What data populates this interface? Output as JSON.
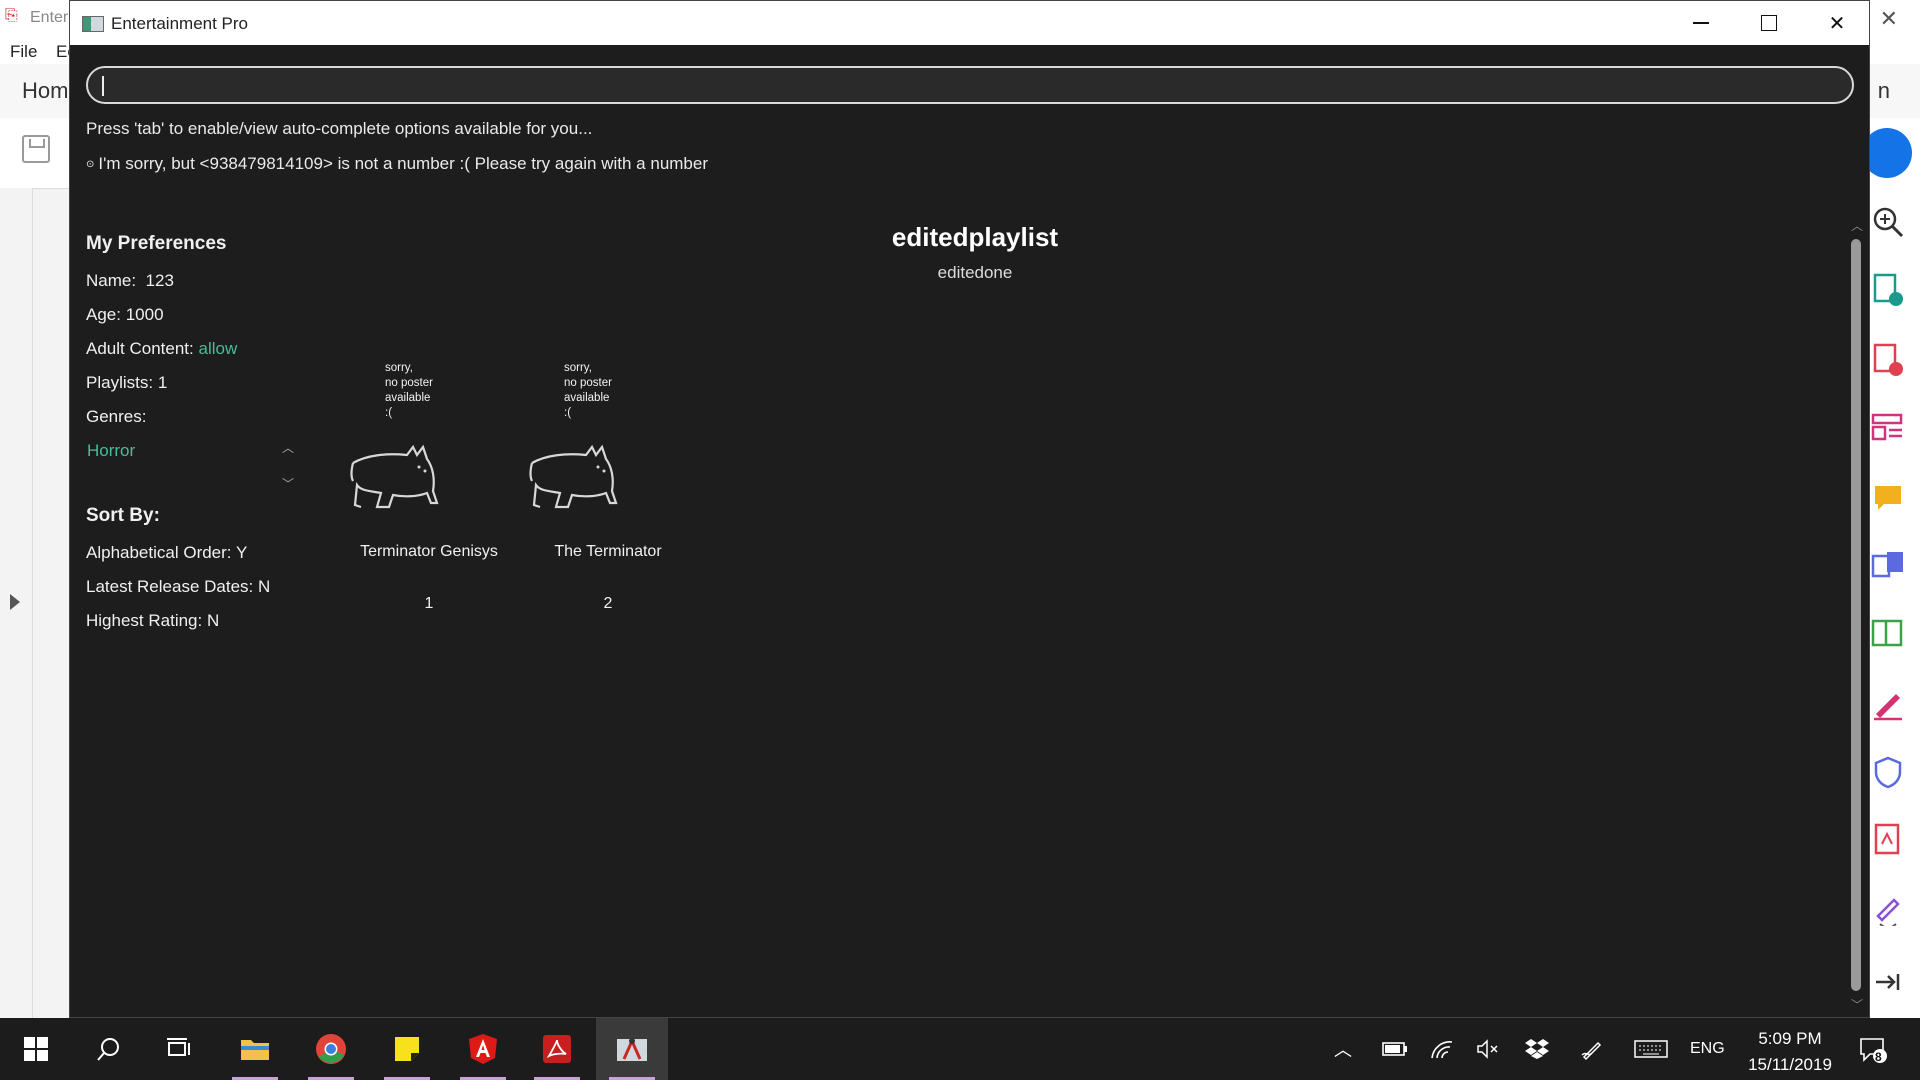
{
  "background_app": {
    "title": "Enter",
    "menu": [
      "File",
      "Ec"
    ],
    "tab_home": "Hom",
    "tab_right_char": "n"
  },
  "app": {
    "title": "Entertainment Pro",
    "search": {
      "value": "",
      "placeholder": ""
    },
    "hint": "Press 'tab' to enable/view auto-complete options available for you...",
    "error_bullet": "⊙",
    "error": "I'm sorry, but <938479814109> is not a number :( Please try again with a number",
    "preferences": {
      "heading": "My Preferences",
      "name_label": "Name:",
      "name_value": "123",
      "age_label": "Age:",
      "age_value": "1000",
      "adult_label": "Adult Content:",
      "adult_value": "allow",
      "playlists_label": "Playlists:",
      "playlists_value": "1",
      "genres_label": "Genres:",
      "genres": [
        "Horror"
      ]
    },
    "sort": {
      "heading": "Sort By:",
      "alpha_label": "Alphabetical Order:",
      "alpha_value": "Y",
      "latest_label": "Latest Release Dates:",
      "latest_value": "N",
      "rating_label": "Highest Rating:",
      "rating_value": "N"
    },
    "playlist": {
      "name": "editedplaylist",
      "description": "editedone",
      "movies": [
        {
          "poster_text": [
            "sorry,",
            "no poster",
            "available",
            ":("
          ],
          "title": "Terminator Genisys",
          "number": "1"
        },
        {
          "poster_text": [
            "sorry,",
            "no poster",
            "available",
            ":("
          ],
          "title": "The Terminator",
          "number": "2"
        }
      ]
    }
  },
  "taskbar": {
    "language": "ENG",
    "time": "5:09 PM",
    "date": "15/11/2019",
    "notifications": "8"
  }
}
